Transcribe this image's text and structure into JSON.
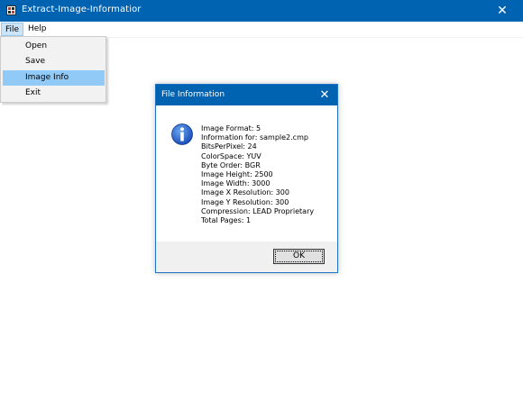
{
  "window": {
    "title": "Extract-Image-Informatior",
    "close_symbol": "✕",
    "app_icon": "app-grid-icon"
  },
  "menubar": {
    "file": "File",
    "help": "Help"
  },
  "file_menu": {
    "items": [
      {
        "label": "Open",
        "highlighted": false
      },
      {
        "label": "Save",
        "highlighted": false
      },
      {
        "label": "Image Info",
        "highlighted": true
      },
      {
        "label": "Exit",
        "highlighted": false
      }
    ]
  },
  "dialog": {
    "title": "File Information",
    "close_symbol": "✕",
    "icon": "information-icon",
    "lines": [
      "Image Format: 5",
      "Information for: sample2.cmp",
      "BitsPerPixel: 24",
      "ColorSpace: YUV",
      "Byte Order: BGR",
      "Image Height: 2500",
      "Image Width: 3000",
      "Image X Resolution: 300",
      "Image Y Resolution: 300",
      "Compression: LEAD Proprietary",
      "Total Pages: 1"
    ],
    "ok_label": "OK"
  },
  "colors": {
    "titlebar": "#0063b1",
    "menu_highlight": "#91c9f7",
    "dialog_footer": "#f0f0f0"
  }
}
